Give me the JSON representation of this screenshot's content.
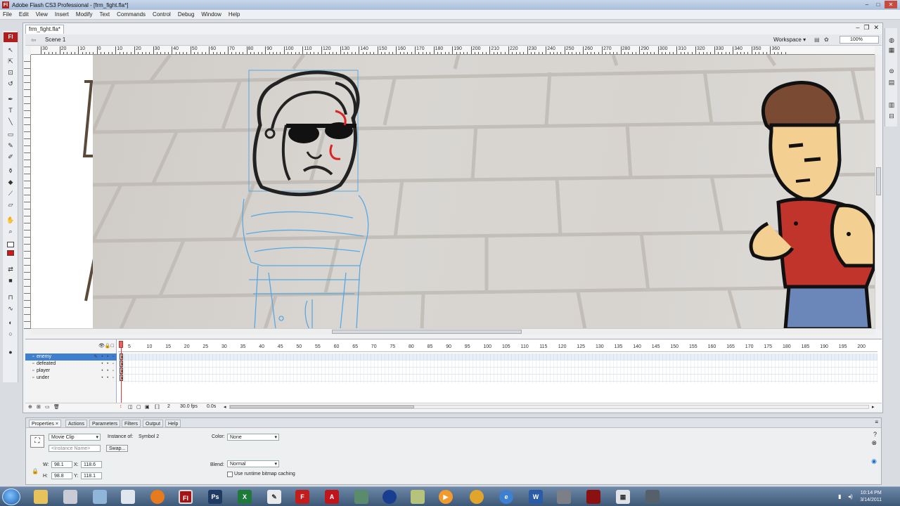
{
  "window": {
    "title": "Adobe Flash CS3 Professional - [frm_fight.fla*]",
    "logo": "Fl"
  },
  "menu": [
    "File",
    "Edit",
    "View",
    "Insert",
    "Modify",
    "Text",
    "Commands",
    "Control",
    "Debug",
    "Window",
    "Help"
  ],
  "document": {
    "tab": "frm_fight.fla*",
    "scene": "Scene 1",
    "workspace": "Workspace ▾",
    "zoom": "100%"
  },
  "ruler_labels": [
    "30",
    "20",
    "10",
    "0",
    "10",
    "20",
    "30",
    "40",
    "50",
    "60",
    "70",
    "80",
    "90",
    "100",
    "110",
    "120",
    "130",
    "140",
    "150",
    "160",
    "170",
    "180",
    "190",
    "200",
    "210",
    "220",
    "230",
    "240",
    "250",
    "260",
    "270",
    "280",
    "290",
    "300",
    "310",
    "320",
    "330",
    "340",
    "350",
    "360"
  ],
  "timeline": {
    "layers": [
      {
        "name": "enemy",
        "selected": true
      },
      {
        "name": "defeated",
        "selected": false
      },
      {
        "name": "player",
        "selected": false
      },
      {
        "name": "under",
        "selected": false
      }
    ],
    "frame_numbers": [
      "5",
      "10",
      "15",
      "20",
      "25",
      "30",
      "35",
      "40",
      "45",
      "50",
      "55",
      "60",
      "65",
      "70",
      "75",
      "80",
      "85",
      "90",
      "95",
      "100",
      "105",
      "110",
      "115",
      "120",
      "125",
      "130",
      "135",
      "140",
      "145",
      "150",
      "155",
      "160",
      "165",
      "170",
      "175",
      "180",
      "185",
      "190",
      "195",
      "200"
    ],
    "current_frame": "2",
    "fps": "30.0 fps",
    "elapsed": "0.0s"
  },
  "properties": {
    "tabs": [
      "Properties ×",
      "Actions",
      "Parameters",
      "Filters",
      "Output",
      "Help"
    ],
    "symbol_type": "Movie Clip",
    "instance_of_label": "Instance of:",
    "instance_of_value": "Symbol 2",
    "instance_name_placeholder": "<Instance Name>",
    "swap_label": "Swap...",
    "color_label": "Color:",
    "color_value": "None",
    "blend_label": "Blend:",
    "blend_value": "Normal",
    "cache_label": "Use runtime bitmap caching",
    "w_label": "W:",
    "w_value": "98.1",
    "h_label": "H:",
    "h_value": "98.8",
    "x_label": "X:",
    "x_value": "118.6",
    "y_label": "Y:",
    "y_value": "118.1"
  },
  "taskbar": {
    "apps": [
      "Fl",
      "Ps",
      "X",
      "F",
      "W"
    ],
    "clock_time": "10:14 PM",
    "clock_date": "3/14/2011"
  },
  "colors": {
    "brand_red": "#b11e1e",
    "selection_blue": "#3f7fd0",
    "outline_blue": "#5aa8e0"
  }
}
